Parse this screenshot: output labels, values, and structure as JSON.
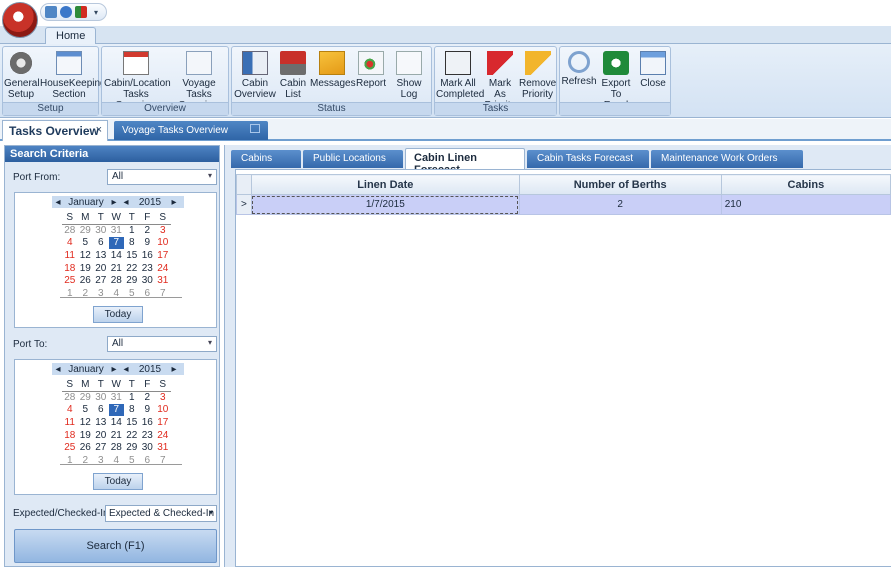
{
  "ribbon": {
    "tab_home": "Home",
    "groups": [
      {
        "label": "Setup",
        "buttons": [
          {
            "label": "General\nSetup",
            "icon": "gear-icon"
          },
          {
            "label": "HouseKeeping\nSection",
            "icon": "calendar-person-icon"
          }
        ]
      },
      {
        "label": "Overview",
        "buttons": [
          {
            "label": "Cabin/Location\nTasks Overview",
            "icon": "calendar-day-icon"
          },
          {
            "label": "Voyage Tasks\nOverview",
            "icon": "page-icon"
          }
        ]
      },
      {
        "label": "Status",
        "buttons": [
          {
            "label": "Cabin\nOverview",
            "icon": "info-panel-icon"
          },
          {
            "label": "Cabin\nList",
            "icon": "toolbox-icon"
          },
          {
            "label": "Messages",
            "icon": "envelope-icon"
          },
          {
            "label": "Report",
            "icon": "report-icon"
          },
          {
            "label": "Show Log",
            "icon": "log-icon"
          }
        ]
      },
      {
        "label": "Tasks",
        "buttons": [
          {
            "label": "Mark All\nCompleted",
            "icon": "checked-page-icon"
          },
          {
            "label": "Mark As\nPriority",
            "icon": "red-flag-icon"
          },
          {
            "label": "Remove\nPriority",
            "icon": "yellow-flag-icon"
          }
        ]
      },
      {
        "label": "",
        "buttons": [
          {
            "label": "Refresh",
            "icon": "refresh-icon"
          },
          {
            "label": "Export\nTo Excel",
            "icon": "excel-icon"
          },
          {
            "label": "Close",
            "icon": "close-window-icon"
          }
        ]
      }
    ]
  },
  "doc_tabs": {
    "tasks_overview": "Tasks Overview",
    "tasks_close": "×",
    "voyage_tasks": "Voyage Tasks Overview"
  },
  "left": {
    "header": "Search Criteria",
    "port_from_label": "Port From:",
    "port_from_value": "All",
    "port_to_label": "Port To:",
    "port_to_value": "All",
    "calendar": {
      "month": "January",
      "year": "2015",
      "weekdays": [
        "S",
        "M",
        "T",
        "W",
        "T",
        "F",
        "S"
      ],
      "weeks": [
        [
          "28",
          "29",
          "30",
          "31",
          "1",
          "2",
          "3"
        ],
        [
          "4",
          "5",
          "6",
          "7",
          "8",
          "9",
          "10"
        ],
        [
          "11",
          "12",
          "13",
          "14",
          "15",
          "16",
          "17"
        ],
        [
          "18",
          "19",
          "20",
          "21",
          "22",
          "23",
          "24"
        ],
        [
          "25",
          "26",
          "27",
          "28",
          "29",
          "30",
          "31"
        ],
        [
          "1",
          "2",
          "3",
          "4",
          "5",
          "6",
          "7"
        ]
      ],
      "selected_day": "7",
      "today_label": "Today"
    },
    "expected_label": "Expected/Checked-In:",
    "expected_value": "Expected & Checked-In",
    "search_label": "Search (F1)"
  },
  "inner_tabs": [
    "Cabins",
    "Public Locations",
    "Cabin Linen Forecast",
    "Cabin Tasks Forecast",
    "Maintenance Work Orders"
  ],
  "active_inner_tab": "Cabin Linen Forecast",
  "grid": {
    "columns": [
      "Linen Date",
      "Number of Berths",
      "Cabins"
    ],
    "rows": [
      {
        "indicator": ">",
        "linen_date": "1/7/2015",
        "berths": "2",
        "cabins": "210"
      }
    ]
  },
  "colors": {
    "accent": "#2f68b8",
    "weekend": "#e02a1e",
    "row_selected": "#c9cff7"
  }
}
